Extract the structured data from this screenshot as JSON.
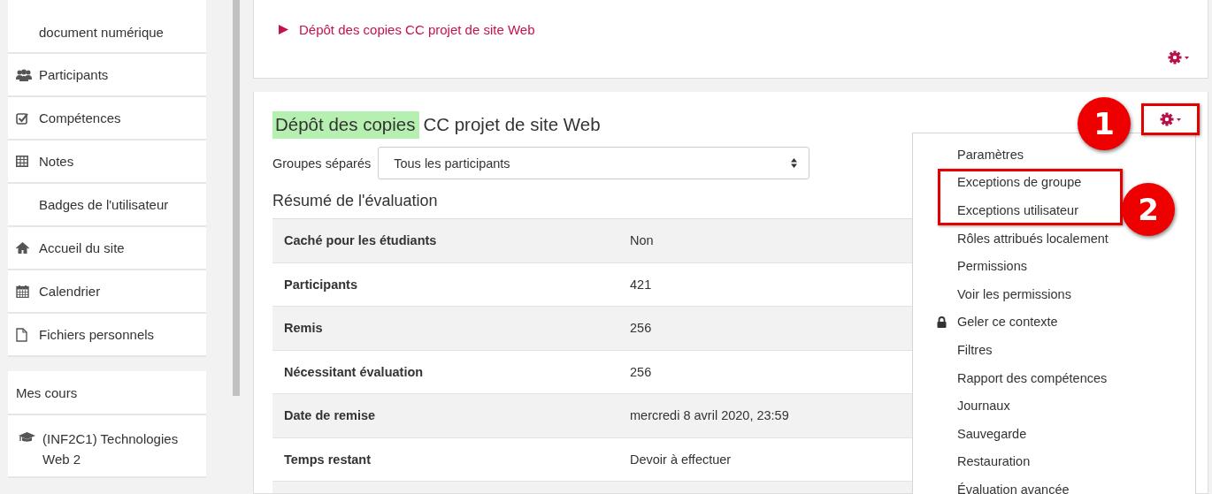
{
  "sidebar": {
    "items": [
      {
        "label": "document numérique",
        "kind": "plain"
      },
      {
        "label": "Participants",
        "kind": "users"
      },
      {
        "label": "Compétences",
        "kind": "check"
      },
      {
        "label": "Notes",
        "kind": "table"
      },
      {
        "label": "Badges de l'utilisateur",
        "kind": "plain"
      },
      {
        "label": "Accueil du site",
        "kind": "home"
      },
      {
        "label": "Calendrier",
        "kind": "calendar"
      },
      {
        "label": "Fichiers personnels",
        "kind": "file"
      }
    ],
    "courses_block": {
      "title": "Mes cours",
      "items": [
        {
          "label": "(INF2C1) Technologies Web 2",
          "kind": "course"
        }
      ]
    }
  },
  "breadcrumb": [
    {
      "label": "Dépôt des copies CC projet de site Web"
    }
  ],
  "assignment": {
    "title_highlighted": "Dépôt des copies",
    "title_rest": "CC projet de site Web",
    "groups": {
      "label": "Groupes séparés",
      "value": "Tous les participants"
    },
    "summary_heading": "Résumé de l'évaluation",
    "rows": [
      {
        "label": "Caché pour les étudiants",
        "value": "Non"
      },
      {
        "label": "Participants",
        "value": "421"
      },
      {
        "label": "Remis",
        "value": "256"
      },
      {
        "label": "Nécessitant évaluation",
        "value": "256"
      },
      {
        "label": "Date de remise",
        "value": "mercredi 8 avril 2020, 23:59"
      },
      {
        "label": "Temps restant",
        "value": "Devoir à effectuer"
      }
    ]
  },
  "settings_menu": {
    "expanded": true,
    "items": [
      {
        "label": "Paramètres",
        "kind": "plain"
      },
      {
        "label": "Exceptions de groupe",
        "kind": "plain"
      },
      {
        "label": "Exceptions utilisateur",
        "kind": "plain"
      },
      {
        "label": "Rôles attribués localement",
        "kind": "plain"
      },
      {
        "label": "Permissions",
        "kind": "plain"
      },
      {
        "label": "Voir les permissions",
        "kind": "plain"
      },
      {
        "label": "Geler ce contexte",
        "kind": "locked"
      },
      {
        "label": "Filtres",
        "kind": "plain"
      },
      {
        "label": "Rapport des compétences",
        "kind": "plain"
      },
      {
        "label": "Journaux",
        "kind": "plain"
      },
      {
        "label": "Sauvegarde",
        "kind": "plain"
      },
      {
        "label": "Restauration",
        "kind": "plain"
      },
      {
        "label": "Évaluation avancée",
        "kind": "plain"
      }
    ]
  },
  "callouts": [
    {
      "label": "1"
    },
    {
      "label": "2"
    }
  ]
}
